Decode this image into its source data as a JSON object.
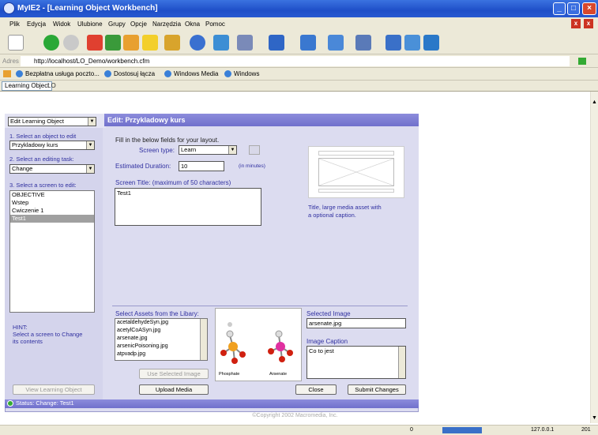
{
  "window": {
    "title": "MyIE2 - [Learning Object Workbench]"
  },
  "menu": [
    "Plik",
    "Edycja",
    "Widok",
    "Ulubione",
    "Grupy",
    "Opcje",
    "Narzędzia",
    "Okna",
    "Pomoc"
  ],
  "address": {
    "label": "Adres",
    "url": "http://localhost/LO_Demo/workbench.cfm"
  },
  "links": [
    "Bezpłatna usługa poczto...",
    "Dostosuj łącza",
    "Windows Media",
    "Windows"
  ],
  "tabs": [
    {
      "label": "Learning Object"
    },
    {
      "label": "LO"
    }
  ],
  "sidebar": {
    "mode_select": "Edit Learning Object",
    "step1": "1. Select an object to edit",
    "object_select": "Przykladowy kurs",
    "step2": "2. Select an editing task:",
    "task_select": "Change",
    "step3": "3. Select a screen to edit:",
    "screens": [
      "OBJECTIVE",
      "Wstep",
      "Cwiczenie 1",
      "Test1"
    ],
    "selected_screen": "Test1",
    "hint": "HINT:\nSelect a screen to Change its contents",
    "hint_line1": "HINT:",
    "hint_line2": "Select a screen to Change",
    "hint_line3": "its contents",
    "view_button": "View Learning Object"
  },
  "editor": {
    "header": "Edit: Przykladowy kurs",
    "instructions": "Fill in the below fields for your layout.",
    "screen_type_label": "Screen type:",
    "screen_type_value": "Learn",
    "duration_label": "Estimated Duration:",
    "duration_value": "10",
    "duration_unit": "(in minutes)",
    "title_label": "Screen Title: (maximum of 50 characters)",
    "title_value": "Test1",
    "layout_caption_1": "Title, large media asset with",
    "layout_caption_2": "a optional caption."
  },
  "assets": {
    "label": "Select Assets from the Libary:",
    "items": [
      "acetaldehydeSyn.jpg",
      "acetylCoASyn.jpg",
      "arsenate.jpg",
      "arsenicPoisoning.jpg",
      "atpvadp.jpg"
    ],
    "use_button": "Use Selected Image",
    "upload_button": "Upload Media",
    "preview_left": "Phosphate",
    "preview_right": "Arsenate"
  },
  "selected_image": {
    "label": "Selected Image",
    "value": "arsenate.jpg",
    "caption_label": "Image Caption",
    "caption_value": "Co to jest"
  },
  "buttons": {
    "close": "Close",
    "submit": "Submit Changes"
  },
  "status": "Status: Change: Test1",
  "copyright": "©Copyright 2002 Macromedia, Inc.",
  "statusbar": {
    "count": "0",
    "ip": "127.0.0.1",
    "year": "201"
  },
  "colors": {
    "accent": "#7070cc",
    "panel": "#dcdcf0",
    "titlebar": "#1f4fc8"
  }
}
